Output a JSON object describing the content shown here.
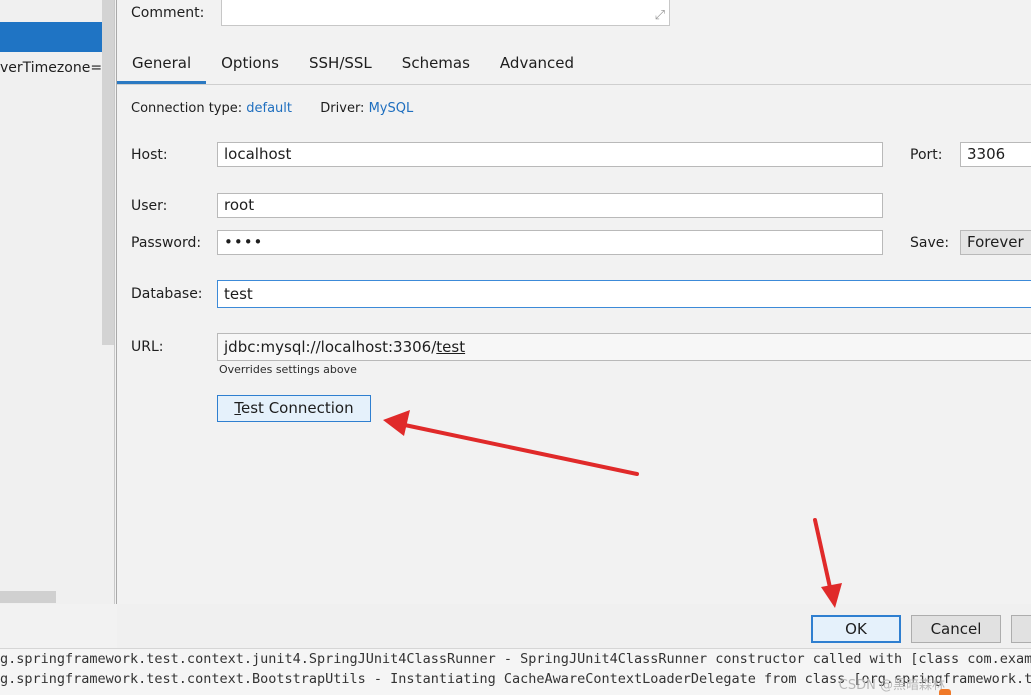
{
  "left": {
    "url_fragment": "verTimezone=G"
  },
  "dialog": {
    "comment_label": "Comment:",
    "tabs": [
      {
        "label": "General",
        "active": true
      },
      {
        "label": "Options",
        "active": false
      },
      {
        "label": "SSH/SSL",
        "active": false
      },
      {
        "label": "Schemas",
        "active": false
      },
      {
        "label": "Advanced",
        "active": false
      }
    ],
    "connection_type_label": "Connection type:",
    "connection_type_value": "default",
    "driver_label": "Driver:",
    "driver_value": "MySQL",
    "host_label": "Host:",
    "host_value": "localhost",
    "port_label": "Port:",
    "port_value": "3306",
    "user_label": "User:",
    "user_value": "root",
    "password_label": "Password:",
    "password_value": "••••",
    "save_label": "Save:",
    "save_value": "Forever",
    "database_label": "Database:",
    "database_value": "test",
    "url_label": "URL:",
    "url_prefix": "jdbc:mysql://localhost:3306/",
    "url_db": "test",
    "url_hint": "Overrides settings above",
    "test_connection_mnemonic": "T",
    "test_connection_rest": "est Connection",
    "ok_label": "OK",
    "cancel_label": "Cancel"
  },
  "console": {
    "line1": "g.springframework.test.context.junit4.SpringJUnit4ClassRunner - SpringJUnit4ClassRunner constructor called with [class com.example",
    "line2": "g.springframework.test.context.BootstrapUtils - Instantiating CacheAwareContextLoaderDelegate from class [org.springframework.test",
    "watermark": "CSDN @黑暗森林"
  },
  "colors": {
    "accent": "#2b79c2",
    "link": "#1f6fbf",
    "selection": "#1f74c4",
    "annotation_arrow": "#e02a2a"
  }
}
